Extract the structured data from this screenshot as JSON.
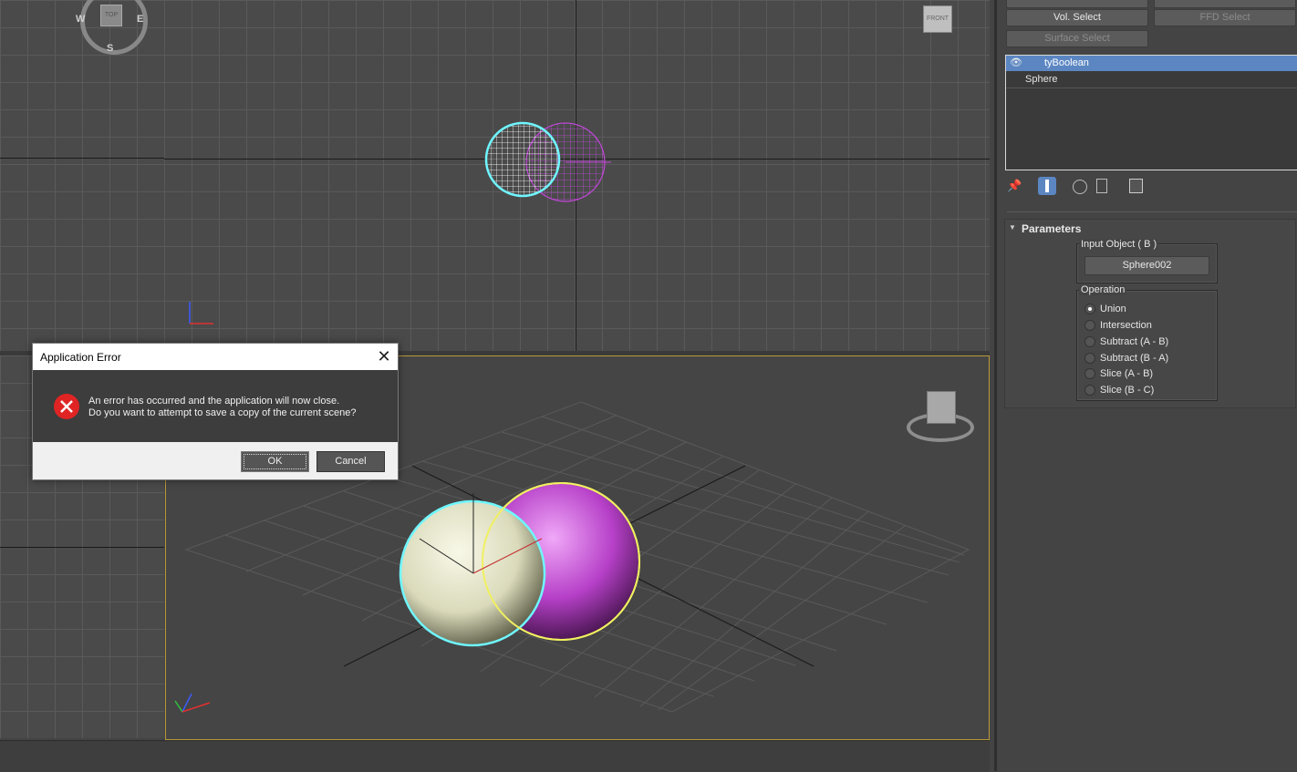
{
  "viewports": {
    "top": {
      "compass": {
        "label": "TOP",
        "w": "W",
        "e": "E",
        "s": "S"
      }
    },
    "front": {
      "viewcube_label": "FRONT"
    }
  },
  "command_panel": {
    "buttons": {
      "vol_select": "Vol. Select",
      "ffd_select": "FFD Select",
      "surface_select": "Surface Select"
    },
    "modifier_stack": [
      "tyBoolean",
      "Sphere"
    ],
    "rollout_title": "Parameters",
    "input_object": {
      "title": "Input Object ( B )",
      "value": "Sphere002"
    },
    "operation": {
      "title": "Operation",
      "options": [
        "Union",
        "Intersection",
        "Subtract (A - B)",
        "Subtract (B - A)",
        "Slice (A - B)",
        "Slice (B - C)"
      ],
      "selected": "Union"
    }
  },
  "dialog": {
    "title": "Application Error",
    "message_line1": "An error has occurred and the application will now close.",
    "message_line2": "Do you want to attempt to save a copy of the current scene?",
    "ok": "OK",
    "cancel": "Cancel"
  },
  "colors": {
    "selection_cyan": "#6ff6ff",
    "boolean_magenta": "#c048d8",
    "highlight_yellow": "#f0f060",
    "stack_selected": "#5b86c2",
    "error_red": "#e02424"
  }
}
